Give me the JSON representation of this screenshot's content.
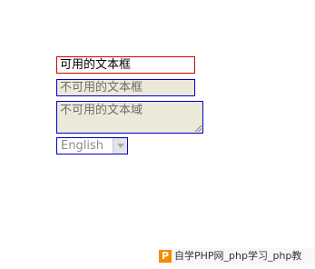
{
  "form": {
    "enabled_input_value": "可用的文本框",
    "disabled_input_value": "不可用的文本框",
    "disabled_textarea_value": "不可用的文本域",
    "language_select": {
      "selected": "English"
    }
  },
  "watermark": {
    "logo_letter": "P",
    "text": "自学PHP网_php学习_php教"
  },
  "colors": {
    "enabled_border": "#d40000",
    "disabled_border": "#0000cc",
    "disabled_background": "#ece9d8",
    "logo_orange": "#f28c00"
  }
}
